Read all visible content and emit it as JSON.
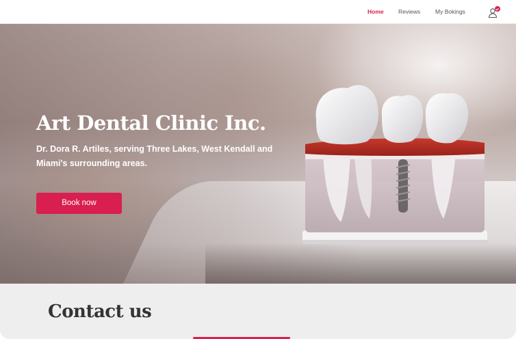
{
  "nav": {
    "home": "Home",
    "reviews": "Reviews",
    "bookings": "My Bokings",
    "accent_color": "#d81f4f"
  },
  "header_icons": {
    "user": "user-icon",
    "notification": "check-badge-icon"
  },
  "hero": {
    "title": "Art Dental Clinic Inc.",
    "subtitle": "Dr. Dora R. Artiles, serving Three Lakes, West Kendall and Miami's surrounding areas.",
    "book_button": "Book now",
    "image": "dental-implant-model"
  },
  "contact": {
    "title": "Contact us"
  }
}
